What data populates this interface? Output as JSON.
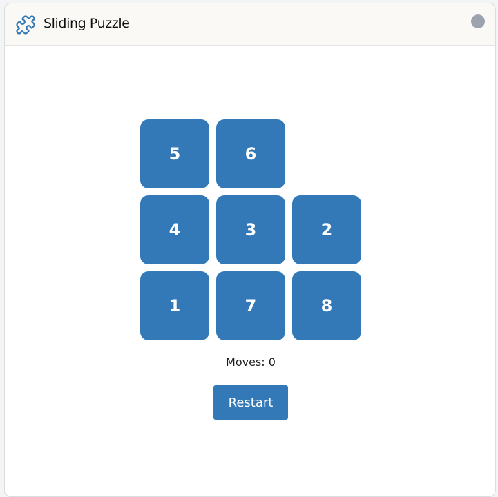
{
  "window": {
    "title": "Sliding Puzzle"
  },
  "colors": {
    "accent": "#3479b7",
    "tile_text": "#ffffff",
    "status_dot": "#9ca3af"
  },
  "puzzle": {
    "grid": [
      [
        "5",
        "6",
        ""
      ],
      [
        "4",
        "3",
        "2"
      ],
      [
        "1",
        "7",
        "8"
      ]
    ]
  },
  "moves_label": "Moves: 0",
  "restart_label": "Restart",
  "icons": {
    "app": "puzzle-piece-icon"
  }
}
